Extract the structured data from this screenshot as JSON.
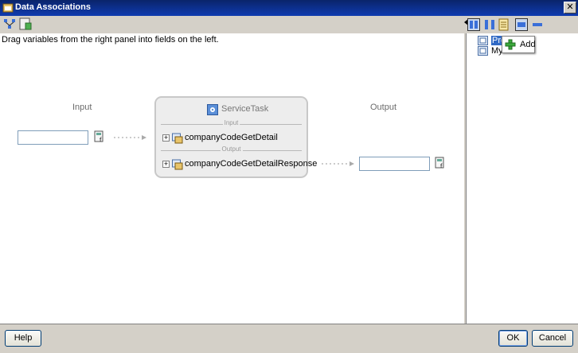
{
  "window": {
    "title": "Data Associations",
    "close_glyph": "✕"
  },
  "toolbar_left": {
    "icons": [
      "associations-icon",
      "expression-icon"
    ]
  },
  "main": {
    "instruction": "Drag variables from the right panel into fields on the left.",
    "input_label": "Input",
    "output_label": "Output",
    "input_field_value": "",
    "output_field_value": "",
    "service": {
      "title": "ServiceTask",
      "input_section": "Input",
      "output_section": "Output",
      "input_item": "companyCodeGetDetail",
      "output_item": "companyCodeGetDetailResponse",
      "expander_glyph": "+"
    }
  },
  "right_panel": {
    "toolbar_icons": [
      "variables-toggle-icon",
      "sort-icon",
      "grid-icon",
      "view-icon",
      "collapse-icon"
    ],
    "items": [
      {
        "label": "Pro",
        "selected": true
      },
      {
        "label": "Mys",
        "selected": false
      }
    ],
    "context_menu": {
      "add_label": "Add"
    }
  },
  "footer": {
    "help_label": "Help",
    "ok_label": "OK",
    "cancel_label": "Cancel"
  },
  "colors": {
    "titlebar": "#0a246a",
    "selection": "#316ac5",
    "service_border": "#c8c8c8"
  }
}
